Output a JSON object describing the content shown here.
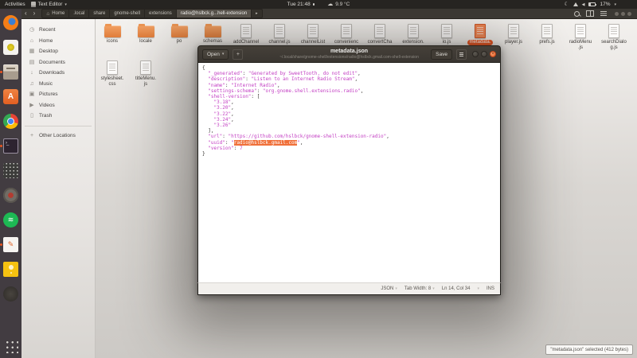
{
  "colors": {
    "accent": "#e95420",
    "selection": "#f0703a",
    "json_string": "#c33fc3"
  },
  "topbar": {
    "activities": "Activities",
    "app_name": "Text Editor",
    "clock": "Tue 21:48",
    "weather": "9.9 °C",
    "battery": "17%"
  },
  "fm": {
    "nav": {
      "back": "‹",
      "forward": "›",
      "sibling": "▸"
    },
    "breadcrumbs": [
      {
        "label": "Home",
        "icon": "home"
      },
      {
        "label": ".local"
      },
      {
        "label": "share"
      },
      {
        "label": "gnome-shell"
      },
      {
        "label": "extensions"
      },
      {
        "label": "radio@hslbck.g...hell-extension",
        "active": true
      }
    ],
    "sidebar": [
      {
        "key": "recent",
        "label": "Recent"
      },
      {
        "key": "home",
        "label": "Home"
      },
      {
        "key": "desktop",
        "label": "Desktop"
      },
      {
        "key": "documents",
        "label": "Documents"
      },
      {
        "key": "downloads",
        "label": "Downloads"
      },
      {
        "key": "music",
        "label": "Music"
      },
      {
        "key": "pictures",
        "label": "Pictures"
      },
      {
        "key": "videos",
        "label": "Videos"
      },
      {
        "key": "trash",
        "label": "Trash"
      }
    ],
    "other_locations": "Other Locations",
    "files": [
      {
        "kind": "folder",
        "lines": [
          "icons"
        ]
      },
      {
        "kind": "folder",
        "lines": [
          "locale"
        ]
      },
      {
        "kind": "folder",
        "lines": [
          "po"
        ]
      },
      {
        "kind": "folder",
        "lines": [
          "schemas"
        ]
      },
      {
        "kind": "file",
        "lines": [
          "addChannel"
        ]
      },
      {
        "kind": "file",
        "lines": [
          "channel.js"
        ]
      },
      {
        "kind": "file",
        "lines": [
          "channelList"
        ]
      },
      {
        "kind": "file",
        "lines": [
          "convenienc"
        ]
      },
      {
        "kind": "file",
        "lines": [
          "convertCha"
        ]
      },
      {
        "kind": "file",
        "lines": [
          "extension."
        ]
      },
      {
        "kind": "file",
        "lines": [
          "io.js"
        ]
      },
      {
        "kind": "file",
        "lines": [
          "metadata."
        ],
        "selected": true
      },
      {
        "kind": "file",
        "lines": [
          "player.js"
        ]
      },
      {
        "kind": "file",
        "lines": [
          "prefs.js"
        ]
      },
      {
        "kind": "file",
        "lines": [
          "radioMenu",
          ".js"
        ]
      },
      {
        "kind": "file",
        "lines": [
          "searchDialo",
          "g.js"
        ]
      },
      {
        "kind": "file",
        "lines": [
          "stylesheet.",
          "css"
        ]
      },
      {
        "kind": "file",
        "lines": [
          "titleMenu.",
          "js"
        ]
      }
    ],
    "status_pill": "\"metadata.json\" selected (412 bytes)"
  },
  "editor": {
    "open_button": "Open",
    "title": "metadata.json",
    "subtitle": "~/.local/share/gnome-shell/extensions/radio@hslbck.gmail.com-shell-extension",
    "save_button": "Save",
    "status": {
      "language": "JSON",
      "tab_width": "Tab Width: 8",
      "position": "Ln 14, Col 34",
      "mode": "INS"
    },
    "lines": [
      [
        [
          "{",
          "p"
        ]
      ],
      [
        [
          "  ",
          "p"
        ],
        [
          "\"_generated\"",
          "s"
        ],
        [
          ": ",
          "p"
        ],
        [
          "\"Generated by SweetTooth, do not edit\"",
          "s"
        ],
        [
          ",",
          "p"
        ]
      ],
      [
        [
          "  ",
          "p"
        ],
        [
          "\"description\"",
          "s"
        ],
        [
          ": ",
          "p"
        ],
        [
          "\"Listen to an Internet Radio Stream\"",
          "s"
        ],
        [
          ",",
          "p"
        ]
      ],
      [
        [
          "  ",
          "p"
        ],
        [
          "\"name\"",
          "s"
        ],
        [
          ": ",
          "p"
        ],
        [
          "\"Internet Radio\"",
          "s"
        ],
        [
          ",",
          "p"
        ]
      ],
      [
        [
          "  ",
          "p"
        ],
        [
          "\"settings-schema\"",
          "s"
        ],
        [
          ": ",
          "p"
        ],
        [
          "\"org.gnome.shell.extensions.radio\"",
          "s"
        ],
        [
          ",",
          "p"
        ]
      ],
      [
        [
          "  ",
          "p"
        ],
        [
          "\"shell-version\"",
          "s"
        ],
        [
          ": [",
          "p"
        ]
      ],
      [
        [
          "    ",
          "p"
        ],
        [
          "\"3.18\"",
          "s"
        ],
        [
          ",",
          "p"
        ]
      ],
      [
        [
          "    ",
          "p"
        ],
        [
          "\"3.20\"",
          "s"
        ],
        [
          ",",
          "p"
        ]
      ],
      [
        [
          "    ",
          "p"
        ],
        [
          "\"3.22\"",
          "s"
        ],
        [
          ",",
          "p"
        ]
      ],
      [
        [
          "    ",
          "p"
        ],
        [
          "\"3.24\"",
          "s"
        ],
        [
          ",",
          "p"
        ]
      ],
      [
        [
          "    ",
          "p"
        ],
        [
          "\"3.26\"",
          "s"
        ]
      ],
      [
        [
          "  ],",
          "p"
        ]
      ],
      [
        [
          "  ",
          "p"
        ],
        [
          "\"url\"",
          "s"
        ],
        [
          ": ",
          "p"
        ],
        [
          "\"https://github.com/hslbck/gnome-shell-extension-radio\"",
          "s"
        ],
        [
          ",",
          "p"
        ]
      ],
      [
        [
          "  ",
          "p"
        ],
        [
          "\"uuid\"",
          "s"
        ],
        [
          ": ",
          "p"
        ],
        [
          "\"",
          "s"
        ],
        [
          "radio@hslbck.gmail.com",
          "sel"
        ],
        [
          "\"",
          "s"
        ],
        [
          ",",
          "p"
        ]
      ],
      [
        [
          "  ",
          "p"
        ],
        [
          "\"version\"",
          "s"
        ],
        [
          ": ",
          "p"
        ],
        [
          "7",
          "n"
        ]
      ],
      [
        [
          "}",
          "p"
        ]
      ]
    ]
  },
  "dock": {
    "items": [
      {
        "key": "firefox",
        "running": false
      },
      {
        "key": "media-player",
        "running": false
      },
      {
        "key": "files",
        "running": true
      },
      {
        "key": "ubuntu-software",
        "running": false
      },
      {
        "key": "chrome",
        "running": false
      },
      {
        "key": "terminal",
        "running": true
      },
      {
        "key": "characters",
        "running": false
      },
      {
        "key": "tweaks",
        "running": false
      },
      {
        "key": "spotify",
        "running": false
      },
      {
        "key": "text-editor",
        "running": true
      },
      {
        "key": "notes",
        "running": false
      },
      {
        "key": "screenshot",
        "running": false
      },
      {
        "key": "show-apps",
        "running": false
      }
    ]
  }
}
